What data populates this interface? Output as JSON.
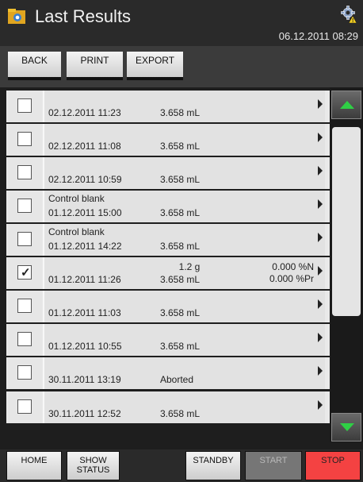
{
  "header": {
    "title": "Last Results",
    "datetime": "06.12.2011 08:29"
  },
  "toolbar": {
    "back_label": "BACK",
    "print_label": "PRINT",
    "export_label": "EXPORT"
  },
  "results": [
    {
      "checked": false,
      "title": "",
      "datetime": "02.12.2011 11:23",
      "amount": "",
      "volume": "3.658 mL",
      "value1": "",
      "value2": ""
    },
    {
      "checked": false,
      "title": "",
      "datetime": "02.12.2011 11:08",
      "amount": "",
      "volume": "3.658 mL",
      "value1": "",
      "value2": ""
    },
    {
      "checked": false,
      "title": "",
      "datetime": "02.12.2011 10:59",
      "amount": "",
      "volume": "3.658 mL",
      "value1": "",
      "value2": ""
    },
    {
      "checked": false,
      "title": "Control blank",
      "datetime": "01.12.2011 15:00",
      "amount": "",
      "volume": "3.658 mL",
      "value1": "",
      "value2": ""
    },
    {
      "checked": false,
      "title": "Control blank",
      "datetime": "01.12.2011 14:22",
      "amount": "",
      "volume": "3.658 mL",
      "value1": "",
      "value2": ""
    },
    {
      "checked": true,
      "title": "",
      "datetime": "01.12.2011 11:26",
      "amount": "1.2 g",
      "volume": "3.658 mL",
      "value1": "0.000 %N",
      "value2": "0.000 %Pr"
    },
    {
      "checked": false,
      "title": "",
      "datetime": "01.12.2011 11:03",
      "amount": "",
      "volume": "3.658 mL",
      "value1": "",
      "value2": ""
    },
    {
      "checked": false,
      "title": "",
      "datetime": "01.12.2011 10:55",
      "amount": "",
      "volume": "3.658 mL",
      "value1": "",
      "value2": ""
    },
    {
      "checked": false,
      "title": "",
      "datetime": "30.11.2011 13:19",
      "amount": "",
      "volume": "Aborted",
      "value1": "",
      "value2": ""
    },
    {
      "checked": false,
      "title": "",
      "datetime": "30.11.2011 12:52",
      "amount": "",
      "volume": "3.658 mL",
      "value1": "",
      "value2": ""
    }
  ],
  "bottom": {
    "home_label": "HOME",
    "show_status_label": "SHOW\nSTATUS",
    "standby_label": "STANDBY",
    "start_label": "START",
    "stop_label": "STOP"
  },
  "colors": {
    "accent_green": "#2fcf45",
    "stop_red": "#f44242"
  },
  "icons": {
    "app": "results-folder-icon",
    "settings": "gear-warning-icon",
    "scroll_up": "arrow-up-icon",
    "scroll_down": "arrow-down-icon",
    "row_open": "chevron-right-icon"
  }
}
